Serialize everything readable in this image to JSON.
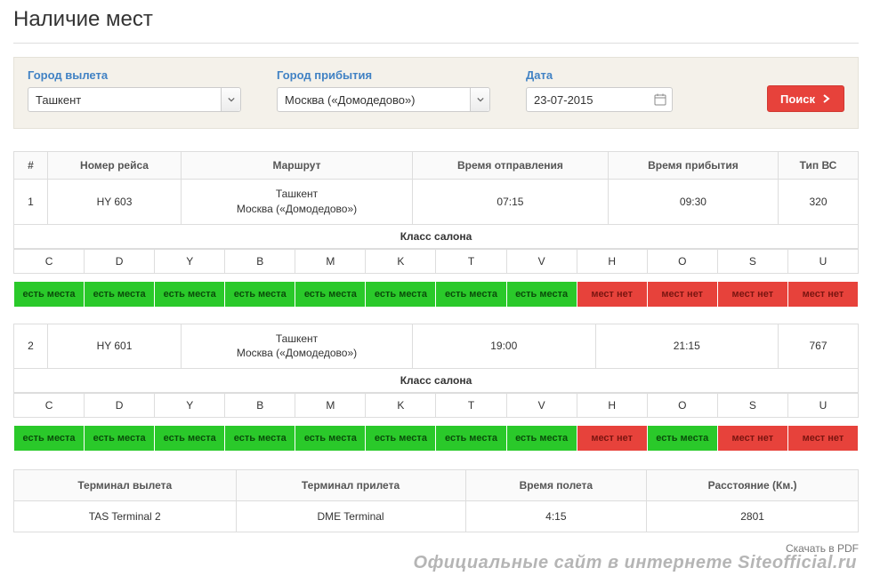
{
  "page_title": "Наличие мест",
  "search": {
    "departure_label": "Город вылета",
    "arrival_label": "Город прибытия",
    "date_label": "Дата",
    "departure_value": "Ташкент",
    "arrival_value": "Москва («Домодедово»)",
    "date_value": "23-07-2015",
    "button_label": "Поиск"
  },
  "columns": {
    "num": "#",
    "flight": "Номер рейса",
    "route": "Маршрут",
    "dep_time": "Время отправления",
    "arr_time": "Время прибытия",
    "aircraft": "Тип ВС"
  },
  "class_header": "Класс салона",
  "class_codes": [
    "C",
    "D",
    "Y",
    "B",
    "M",
    "K",
    "T",
    "V",
    "H",
    "O",
    "S",
    "U"
  ],
  "avail_labels": {
    "yes": "есть места",
    "no": "мест нет"
  },
  "flights": [
    {
      "num": "1",
      "flight_no": "HY 603",
      "route_from": "Ташкент",
      "route_to": "Москва («Домодедово»)",
      "dep_time": "07:15",
      "arr_time": "09:30",
      "aircraft": "320",
      "availability": [
        "yes",
        "yes",
        "yes",
        "yes",
        "yes",
        "yes",
        "yes",
        "yes",
        "no",
        "no",
        "no",
        "no"
      ]
    },
    {
      "num": "2",
      "flight_no": "HY 601",
      "route_from": "Ташкент",
      "route_to": "Москва («Домодедово»)",
      "dep_time": "19:00",
      "arr_time": "21:15",
      "aircraft": "767",
      "availability": [
        "yes",
        "yes",
        "yes",
        "yes",
        "yes",
        "yes",
        "yes",
        "yes",
        "no",
        "yes",
        "no",
        "no"
      ]
    }
  ],
  "summary": {
    "dep_terminal_label": "Терминал вылета",
    "arr_terminal_label": "Терминал прилета",
    "flight_time_label": "Время полета",
    "distance_label": "Расстояние (Км.)",
    "dep_terminal": "TAS Terminal 2",
    "arr_terminal": "DME Terminal",
    "flight_time": "4:15",
    "distance": "2801"
  },
  "pdf_link": "Скачать в PDF",
  "watermark": "Официальные сайт в интернете Siteofficial.ru"
}
